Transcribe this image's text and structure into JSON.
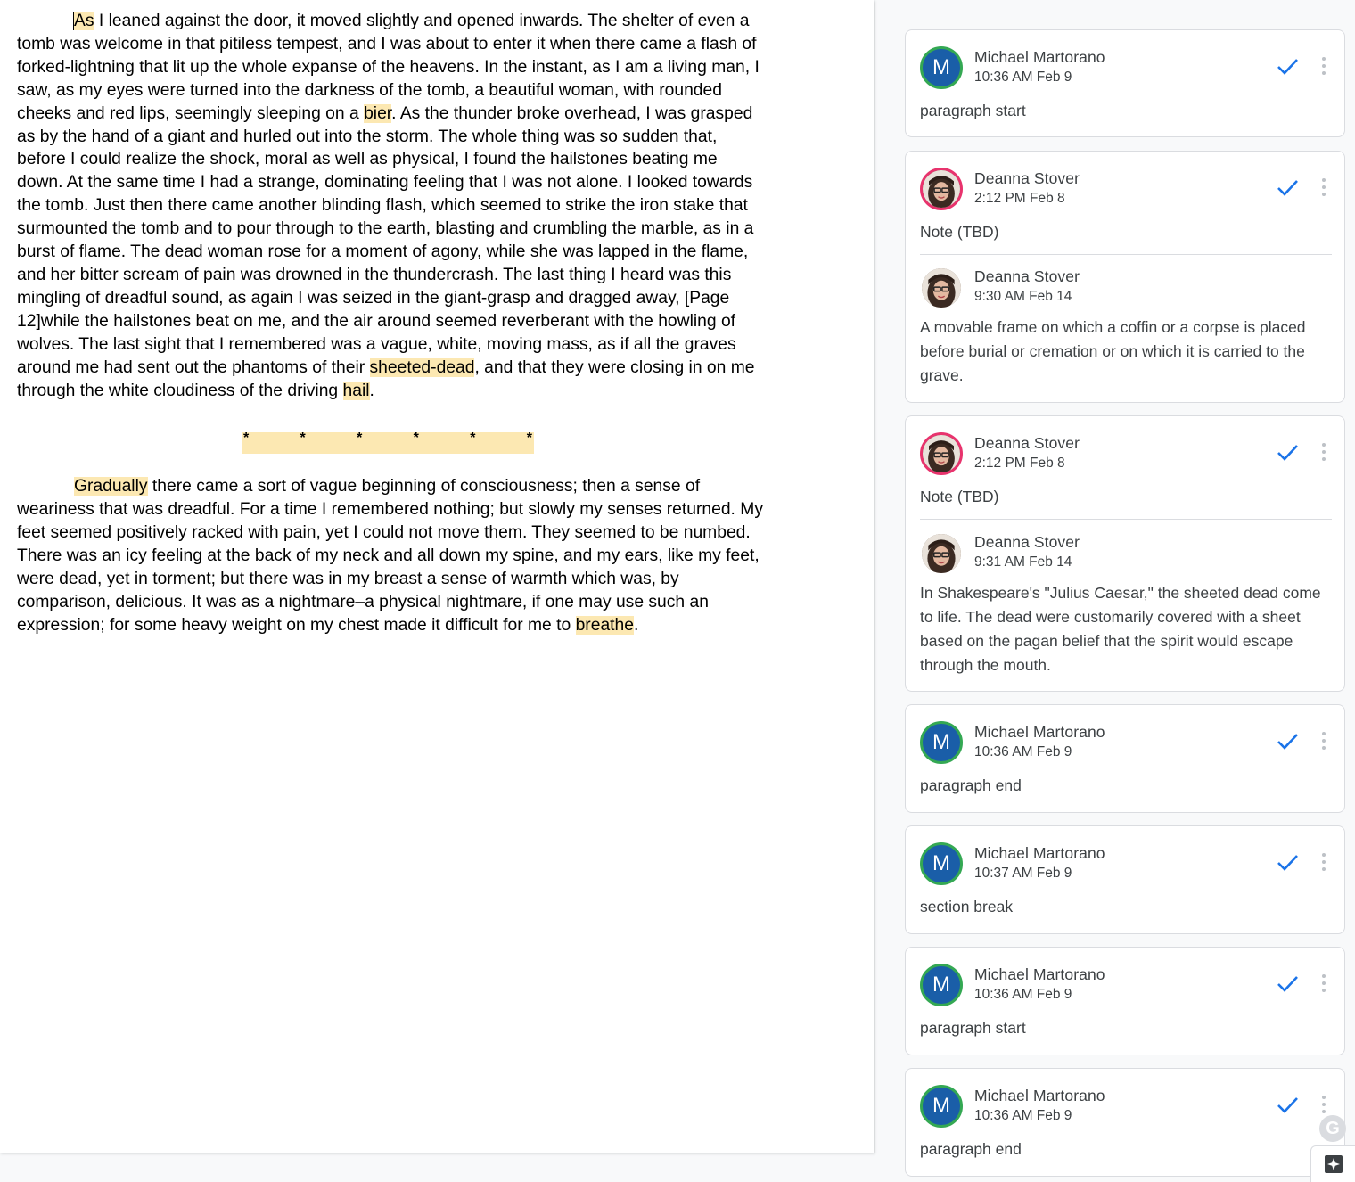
{
  "document": {
    "para1_parts": [
      {
        "text": "As",
        "hl": true,
        "cursor": true
      },
      {
        "text": " I leaned against the door, it moved slightly and opened inwards. The shelter of even a tomb was welcome in that pitiless tempest, and I was about to enter it when there came a flash of forked-lightning that lit up the whole expanse of the heavens. In the instant, as I am a living man, I saw, as my eyes were turned into the darkness of the tomb, a beautiful woman, with rounded cheeks and red lips, seemingly sleeping on a "
      },
      {
        "text": "bier",
        "hl": true
      },
      {
        "text": ". As the thunder broke overhead, I was grasped as by the hand of a giant and hurled out into the storm. The whole thing was so sudden that, before I could realize the shock, moral as well as physical, I found the hailstones beating me down. At the same time I had a strange, dominating feeling that I was not alone. I looked towards the tomb. Just then there came another blinding flash, which seemed to strike the iron stake that surmounted the tomb and to pour through to the earth, blasting and crumbling the marble, as in a burst of flame. The dead woman rose for a moment of agony, while she was lapped in the flame, and her bitter scream of pain was drowned in the thundercrash. The last thing I heard was this mingling of dreadful sound, as again I was seized in the giant-grasp and dragged away, [Page 12]while the hailstones beat on me, and the air around seemed reverberant with the howling of wolves. The last sight that I remembered was a vague, white, moving mass, as if all the graves around me had sent out the phantoms of their "
      },
      {
        "text": "sheeted-dead",
        "hl": true
      },
      {
        "text": ", and that they were closing in on me through the white cloudiness of the driving "
      },
      {
        "text": "hail",
        "hl": true
      },
      {
        "text": "."
      }
    ],
    "section_break_stars": [
      "*",
      "*",
      "*",
      "*",
      "*",
      "*"
    ],
    "para2_parts": [
      {
        "text": "Gradually",
        "hl": true
      },
      {
        "text": " there came a sort of vague beginning of consciousness; then a sense of weariness that was dreadful. For a time I remembered nothing; but slowly my senses returned. My feet seemed positively racked with pain, yet I could not move them. They seemed to be numbed. There was an icy feeling at the back of my neck and all down my spine, and my ears, like my feet, were dead, yet in torment; but there was in my breast a sense of warmth which was, by comparison, delicious. It was as a nightmare–a physical nightmare, if one may use such an expression; for some heavy weight on my chest made it difficult for me to "
      },
      {
        "text": "breathe",
        "hl": true
      },
      {
        "text": "."
      }
    ]
  },
  "comments": [
    {
      "entries": [
        {
          "author": "Michael Martorano",
          "initial": "M",
          "avatar": "initial",
          "time": "10:36 AM Feb 9",
          "text": "paragraph start"
        }
      ]
    },
    {
      "entries": [
        {
          "author": "Deanna Stover",
          "avatar": "photo-ring",
          "time": "2:12 PM Feb 8",
          "text": "Note (TBD)"
        },
        {
          "author": "Deanna Stover",
          "avatar": "photo",
          "time": "9:30 AM Feb 14",
          "text": "A movable frame on which a coffin or a corpse is placed before burial or cremation or on which it is carried to the grave."
        }
      ]
    },
    {
      "entries": [
        {
          "author": "Deanna Stover",
          "avatar": "photo-ring",
          "time": "2:12 PM Feb 8",
          "text": "Note (TBD)"
        },
        {
          "author": "Deanna Stover",
          "avatar": "photo",
          "time": "9:31 AM Feb 14",
          "text": "In Shakespeare's \"Julius Caesar,\" the sheeted dead come to life. The dead were customarily covered with a sheet based on the pagan belief that the spirit would escape through the mouth."
        }
      ]
    },
    {
      "entries": [
        {
          "author": "Michael Martorano",
          "initial": "M",
          "avatar": "initial",
          "time": "10:36 AM Feb 9",
          "text": "paragraph end"
        }
      ]
    },
    {
      "entries": [
        {
          "author": "Michael Martorano",
          "initial": "M",
          "avatar": "initial",
          "time": "10:37 AM Feb 9",
          "text": "section break"
        }
      ]
    },
    {
      "entries": [
        {
          "author": "Michael Martorano",
          "initial": "M",
          "avatar": "initial",
          "time": "10:36 AM Feb 9",
          "text": "paragraph start"
        }
      ]
    },
    {
      "entries": [
        {
          "author": "Michael Martorano",
          "initial": "M",
          "avatar": "initial",
          "time": "10:36 AM Feb 9",
          "text": "paragraph end"
        }
      ]
    }
  ],
  "icons": {
    "resolve": "check-icon",
    "more": "more-vert-icon",
    "grammarly": "grammarly-icon",
    "explore": "explore-sparkle-icon"
  },
  "colors": {
    "highlight": "#fce8b2",
    "check": "#1a73e8",
    "avatar_m_bg": "#1a5ea8",
    "avatar_m_ring": "#34a853",
    "avatar_photo_ring": "#e8336d"
  },
  "grammarly_glyph": "G"
}
